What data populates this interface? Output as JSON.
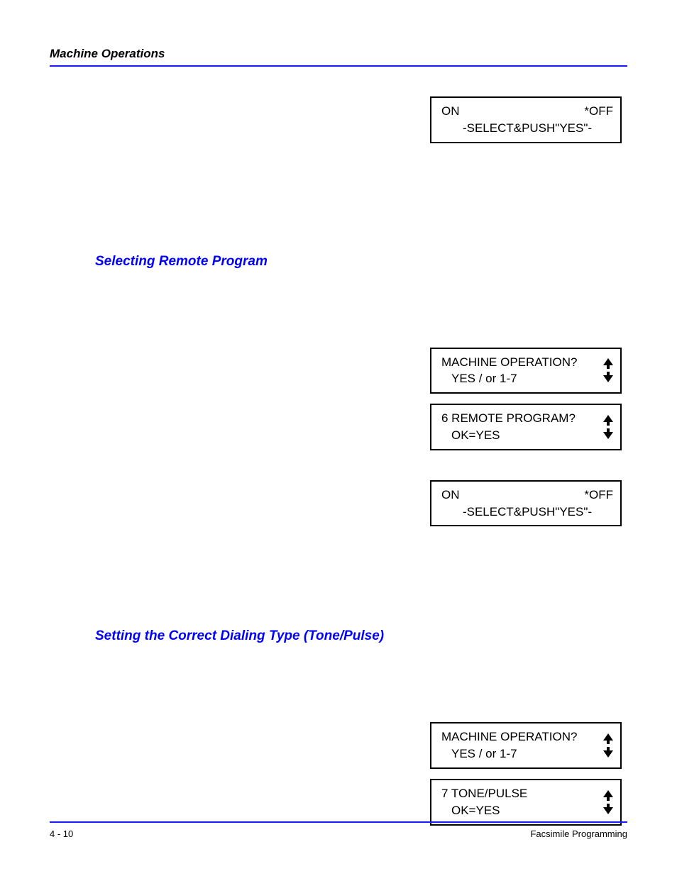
{
  "header": {
    "title": "Machine Operations"
  },
  "box1": {
    "left": "ON",
    "right": "*OFF",
    "line2": "-SELECT&PUSH\"YES\"-"
  },
  "section1": {
    "heading": "Selecting Remote Program"
  },
  "box2": {
    "line1": "MACHINE OPERATION?",
    "line2": "YES / or 1-7"
  },
  "box3": {
    "line1": "6 REMOTE PROGRAM?",
    "line2": "OK=YES"
  },
  "box4": {
    "left": "ON",
    "right": "*OFF",
    "line2": "-SELECT&PUSH\"YES\"-"
  },
  "section2": {
    "heading": "Setting the Correct Dialing Type (Tone/Pulse)"
  },
  "box5": {
    "line1": "MACHINE OPERATION?",
    "line2": "YES / or 1-7"
  },
  "box6": {
    "line1": "7 TONE/PULSE",
    "line2": "OK=YES"
  },
  "footer": {
    "left": "4 - 10",
    "right": "Facsimile Programming"
  }
}
